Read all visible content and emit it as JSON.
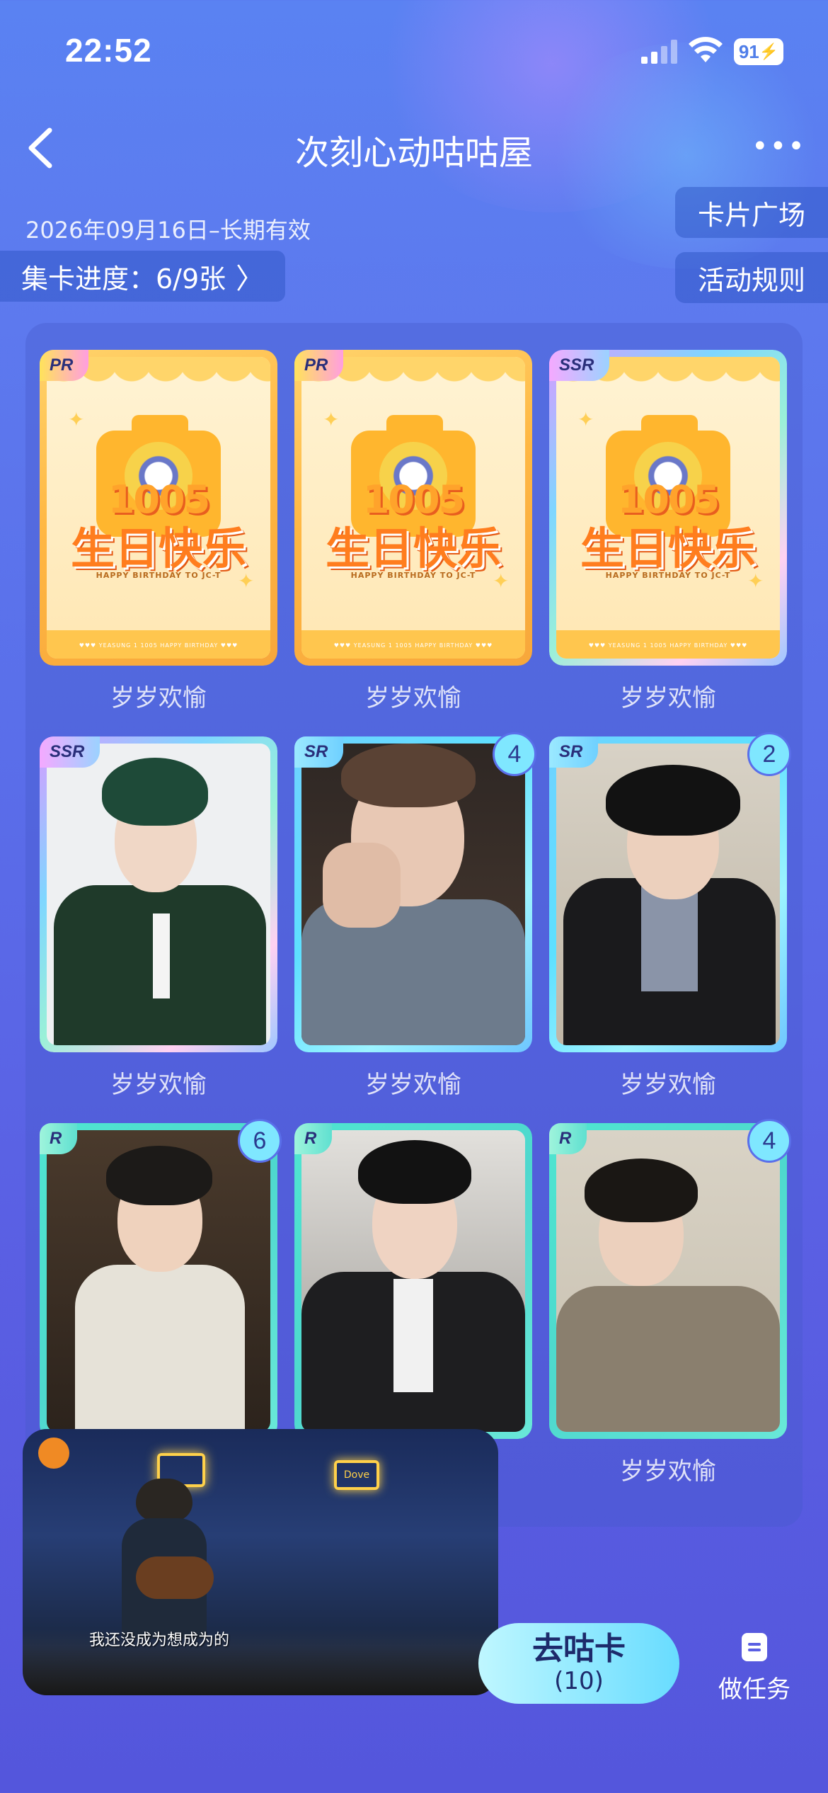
{
  "status_bar": {
    "time": "22:52",
    "battery": "91"
  },
  "header": {
    "title": "次刻心动咕咕屋"
  },
  "validity": "2026年09月16日–长期有效",
  "progress": {
    "label": "集卡进度：6/9张",
    "chevron": "〉"
  },
  "pills": {
    "plaza": "卡片广场",
    "rules": "活动规则"
  },
  "birthday_art": {
    "number": "1005",
    "main": "生日快乐",
    "sub": "HAPPY BIRTHDAY TO JC-T",
    "footer": "♥♥♥   YEASUNG 1 1005   HAPPY BIRTHDAY   ♥♥♥"
  },
  "cards": [
    {
      "rarity": "PR",
      "label": "岁岁欢愉",
      "count": ""
    },
    {
      "rarity": "PR",
      "label": "岁岁欢愉",
      "count": ""
    },
    {
      "rarity": "SSR",
      "label": "岁岁欢愉",
      "count": ""
    },
    {
      "rarity": "SSR",
      "label": "岁岁欢愉",
      "count": ""
    },
    {
      "rarity": "SR",
      "label": "岁岁欢愉",
      "count": "4"
    },
    {
      "rarity": "SR",
      "label": "岁岁欢愉",
      "count": "2"
    },
    {
      "rarity": "R",
      "label": "",
      "count": "6"
    },
    {
      "rarity": "R",
      "label": "",
      "count": ""
    },
    {
      "rarity": "R",
      "label": "岁岁欢愉",
      "count": "4"
    }
  ],
  "video": {
    "subtitle": "我还没成为想成为的",
    "sign": "Dove"
  },
  "bottom": {
    "go_label": "去咕卡",
    "go_count": "(10)",
    "task_label": "做任务"
  }
}
